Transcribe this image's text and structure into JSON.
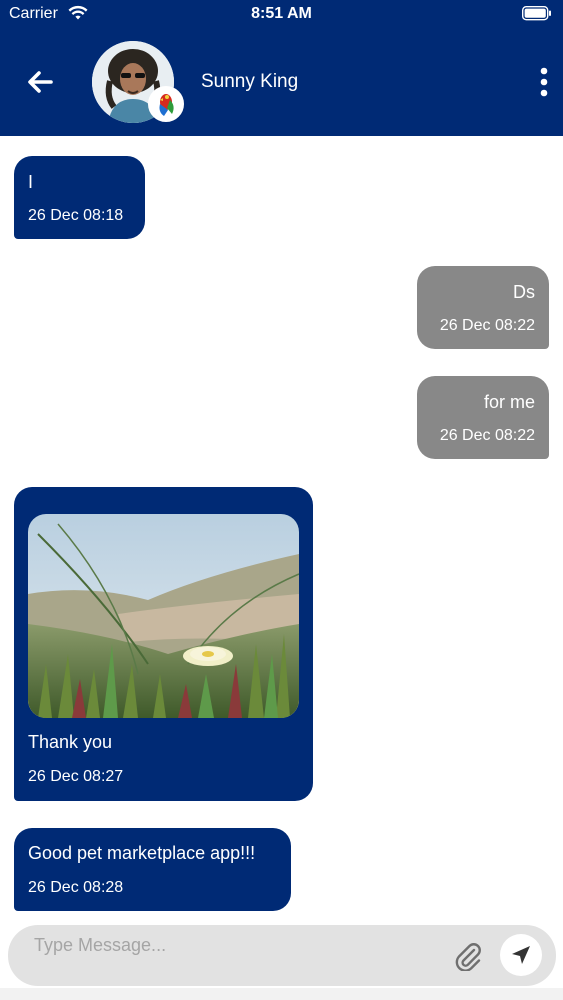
{
  "status_bar": {
    "carrier": "Carrier",
    "time": "8:51 AM",
    "wifi_icon": "wifi-icon",
    "battery_icon": "battery-icon"
  },
  "header": {
    "contact_name": "Sunny King",
    "back_icon": "arrow-left-icon",
    "menu_icon": "more-vertical-icon",
    "background_color": "#002a75"
  },
  "messages": [
    {
      "direction": "incoming",
      "text": "I",
      "timestamp": "26 Dec 08:18"
    },
    {
      "direction": "outgoing",
      "text": "Ds",
      "timestamp": "26 Dec 08:22"
    },
    {
      "direction": "outgoing",
      "text": "for me",
      "timestamp": "26 Dec 08:22"
    },
    {
      "direction": "incoming",
      "text": "Thank you",
      "timestamp": "26 Dec 08:27",
      "has_image": true
    },
    {
      "direction": "incoming",
      "text": "Good pet marketplace app!!!",
      "timestamp": "26 Dec 08:28"
    }
  ],
  "colors": {
    "incoming_bubble": "#002a75",
    "outgoing_bubble": "#888888",
    "input_background": "#e2e2e2"
  },
  "composer": {
    "placeholder": "Type Message...",
    "value": "",
    "attach_icon": "paperclip-icon",
    "send_icon": "send-icon"
  }
}
